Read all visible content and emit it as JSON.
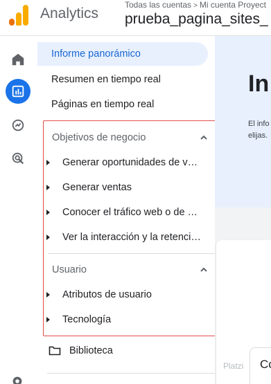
{
  "header": {
    "app_title": "Analytics",
    "breadcrumb_all_accounts": "Todas las cuentas",
    "breadcrumb_separator": ">",
    "breadcrumb_account": "Mi cuenta Proyect",
    "property_name": "prueba_pagina_sites_"
  },
  "rail": {
    "items": [
      {
        "icon": "home-icon",
        "active": false
      },
      {
        "icon": "reports-icon",
        "active": true
      },
      {
        "icon": "explore-icon",
        "active": false
      },
      {
        "icon": "advertising-icon",
        "active": false
      }
    ],
    "accent": "#1a73e8"
  },
  "nav": {
    "overview": "Informe panorámico",
    "realtime_summary": "Resumen en tiempo real",
    "realtime_pages": "Páginas en tiempo real",
    "business_objectives": {
      "title": "Objetivos de negocio",
      "items": [
        "Generar oportunidades de venta",
        "Generar ventas",
        "Conocer el tráfico web o de apps",
        "Ver la interacción y la retención de usuarios"
      ]
    },
    "user": {
      "title": "Usuario",
      "items": [
        "Atributos de usuario",
        "Tecnología"
      ]
    },
    "library": "Biblioteca"
  },
  "main": {
    "hero_title": "In",
    "hero_text_line1": "El info",
    "hero_text_line2": "elijas.",
    "card_text": "Co",
    "watermark": "Platzi"
  },
  "colors": {
    "highlight_border": "#e34b4b",
    "active_bg": "#e8f0fe",
    "active_text": "#1967d2"
  }
}
